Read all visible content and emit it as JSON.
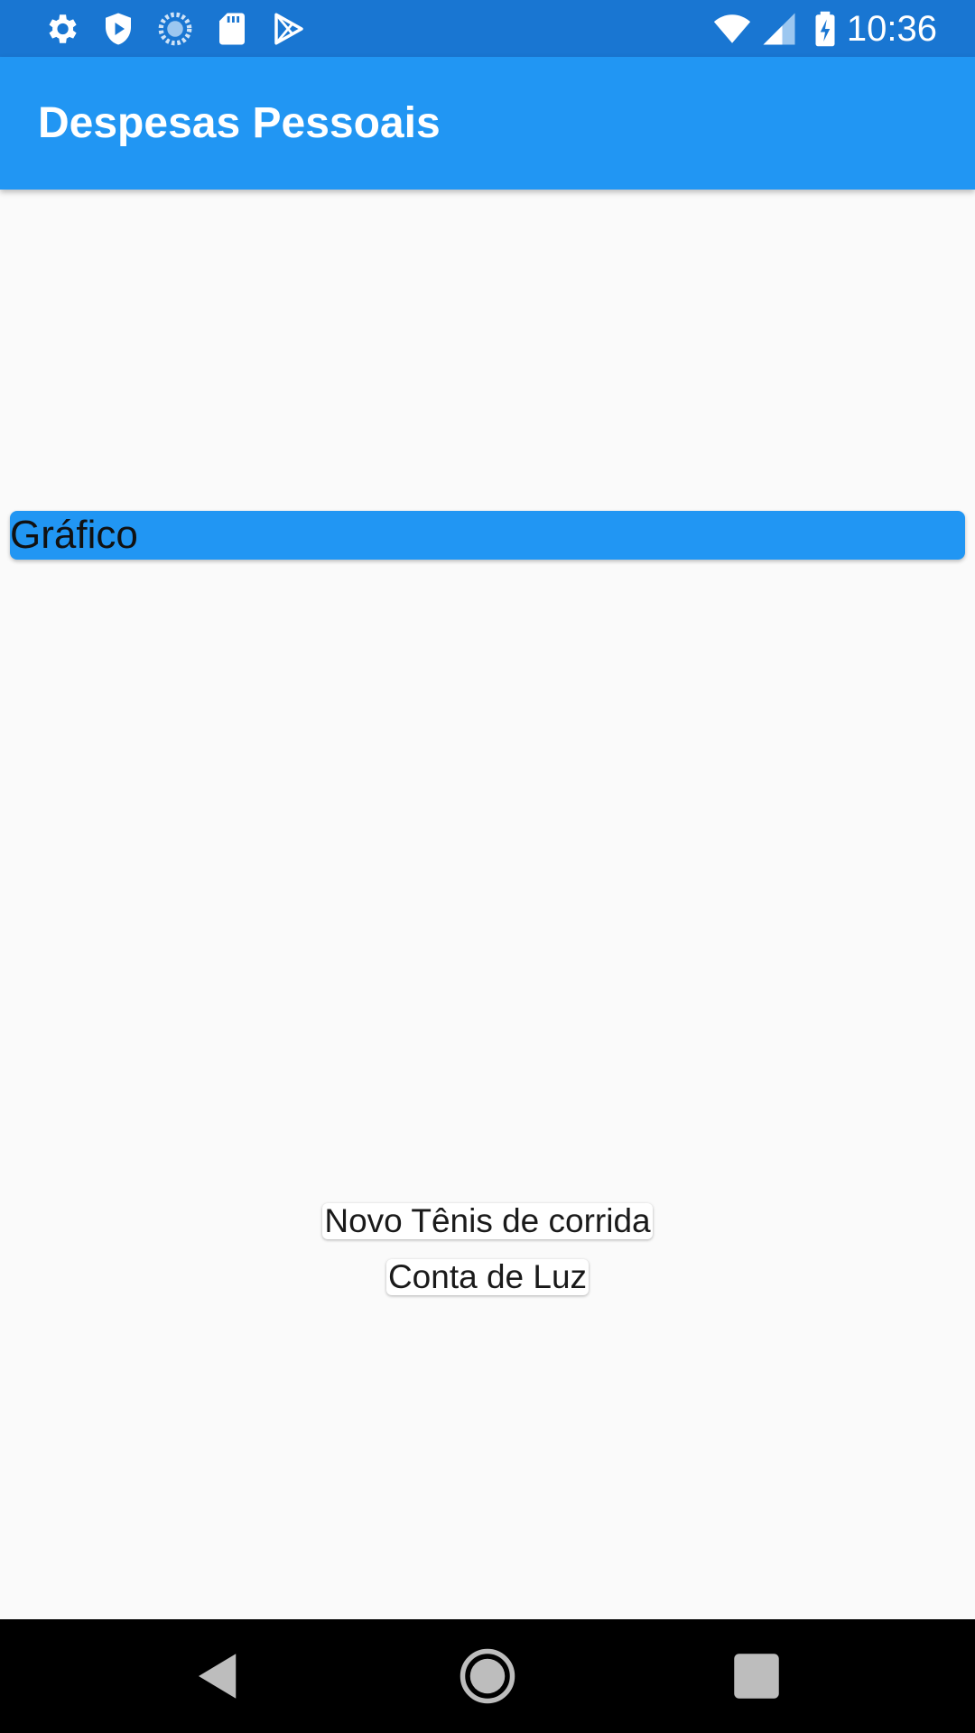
{
  "status_bar": {
    "time": "10:36",
    "left_icons": [
      "gear-icon",
      "shield-play-icon",
      "loading-circle-icon",
      "sd-card-icon",
      "play-store-icon"
    ],
    "right_icons": [
      "wifi-icon",
      "cell-signal-icon",
      "battery-charging-icon"
    ]
  },
  "app_bar": {
    "title": "Despesas Pessoais"
  },
  "chart_card": {
    "label": "Gráfico"
  },
  "transactions": [
    {
      "title": "Novo Tênis de corrida"
    },
    {
      "title": "Conta de Luz"
    }
  ],
  "nav_bar": {
    "buttons": [
      "back-icon",
      "home-icon",
      "recents-icon"
    ]
  },
  "colors": {
    "status_bar": "#1976d2",
    "primary": "#2196f3",
    "background": "#fafafa",
    "nav_bar": "#000000"
  }
}
